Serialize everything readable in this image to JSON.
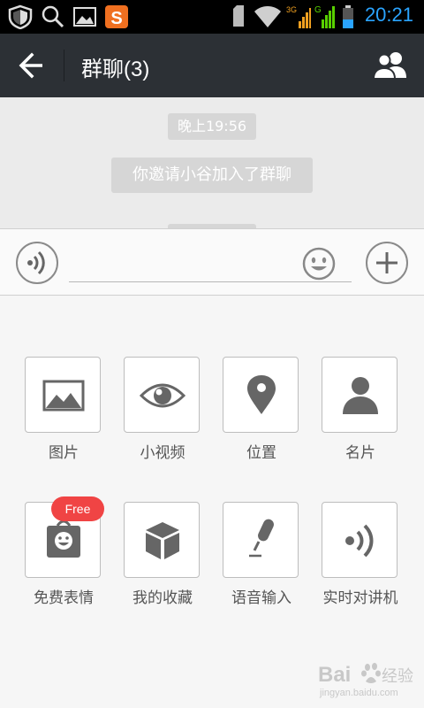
{
  "status_bar": {
    "time": "20:21",
    "icons": [
      "shield-icon",
      "search-icon",
      "gallery-icon",
      "app-s-icon",
      "sd-card-icon",
      "wifi-icon",
      "signal-3g-icon",
      "signal-g-icon",
      "battery-icon"
    ],
    "network_3g": "3G",
    "network_g": "G",
    "time_color": "#2aa4ff"
  },
  "title_bar": {
    "title": "群聊(3)",
    "back_icon": "back-arrow-icon",
    "members_icon": "group-members-icon",
    "background": "#2c3035"
  },
  "chat": {
    "timestamp": "晚上19:56",
    "system_message": "你邀请小谷加入了群聊",
    "background": "#ebebeb"
  },
  "input_bar": {
    "voice_icon": "voice-icon",
    "emoji_icon": "emoji-icon",
    "plus_icon": "plus-icon",
    "text_value": ""
  },
  "panel": {
    "items": [
      {
        "label": "图片",
        "icon": "image-icon"
      },
      {
        "label": "小视频",
        "icon": "eye-video-icon"
      },
      {
        "label": "位置",
        "icon": "location-pin-icon"
      },
      {
        "label": "名片",
        "icon": "contact-card-icon"
      },
      {
        "label": "免费表情",
        "icon": "sticker-bag-icon",
        "badge": "Free"
      },
      {
        "label": "我的收藏",
        "icon": "favorites-box-icon"
      },
      {
        "label": "语音输入",
        "icon": "microphone-icon"
      },
      {
        "label": "实时对讲机",
        "icon": "walkie-talkie-icon"
      }
    ],
    "badge_color": "#f04444"
  },
  "watermark": {
    "brand": "Bai",
    "suffix": "经验",
    "url": "jingyan.baidu.com"
  }
}
